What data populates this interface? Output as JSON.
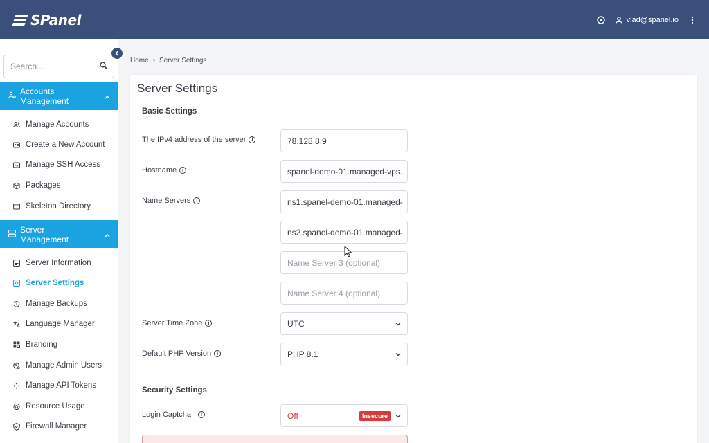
{
  "header": {
    "logo_text": "SPanel",
    "user_email": "vlad@spanel.io",
    "brand_color": "#3a4f7a"
  },
  "sidebar": {
    "search_placeholder": "Search...",
    "accent_color": "#1aa3e0",
    "sections": [
      {
        "label": "Accounts Management",
        "icon": "users-cog-icon",
        "items": [
          {
            "label": "Manage Accounts",
            "icon": "users-icon"
          },
          {
            "label": "Create a New Account",
            "icon": "id-card-icon"
          },
          {
            "label": "Manage SSH Access",
            "icon": "terminal-icon"
          },
          {
            "label": "Packages",
            "icon": "box-icon"
          },
          {
            "label": "Skeleton Directory",
            "icon": "folder-icon"
          }
        ]
      },
      {
        "label": "Server Management",
        "icon": "server-icon",
        "items": [
          {
            "label": "Server Information",
            "icon": "document-icon"
          },
          {
            "label": "Server Settings",
            "icon": "settings-icon",
            "active": true
          },
          {
            "label": "Manage Backups",
            "icon": "history-icon"
          },
          {
            "label": "Language Manager",
            "icon": "translate-icon"
          },
          {
            "label": "Branding",
            "icon": "branding-icon"
          },
          {
            "label": "Manage Admin Users",
            "icon": "admin-user-icon"
          },
          {
            "label": "Manage API Tokens",
            "icon": "api-icon"
          },
          {
            "label": "Resource Usage",
            "icon": "gauge-icon"
          },
          {
            "label": "Firewall Manager",
            "icon": "shield-icon"
          }
        ]
      }
    ]
  },
  "breadcrumb": {
    "home": "Home",
    "separator": "›",
    "current": "Server Settings"
  },
  "page": {
    "title": "Server Settings",
    "basic_settings_title": "Basic Settings",
    "ipv4_label": "The IPv4 address of the server",
    "ipv4_value": "78.128.8.9",
    "hostname_label": "Hostname",
    "hostname_value": "spanel-demo-01.managed-vps.",
    "name_servers_label": "Name Servers",
    "ns1_value": "ns1.spanel-demo-01.managed-",
    "ns2_value": "ns2.spanel-demo-01.managed-",
    "ns3_placeholder": "Name Server 3 (optional)",
    "ns4_placeholder": "Name Server 4 (optional)",
    "timezone_label": "Server Time Zone",
    "timezone_value": "UTC",
    "php_label": "Default PHP Version",
    "php_value": "PHP 8.1",
    "security_settings_title": "Security Settings",
    "captcha_label": "Login Captcha",
    "captcha_value": "Off",
    "captcha_badge": "Insecure",
    "danger_color": "#d83b3b"
  }
}
